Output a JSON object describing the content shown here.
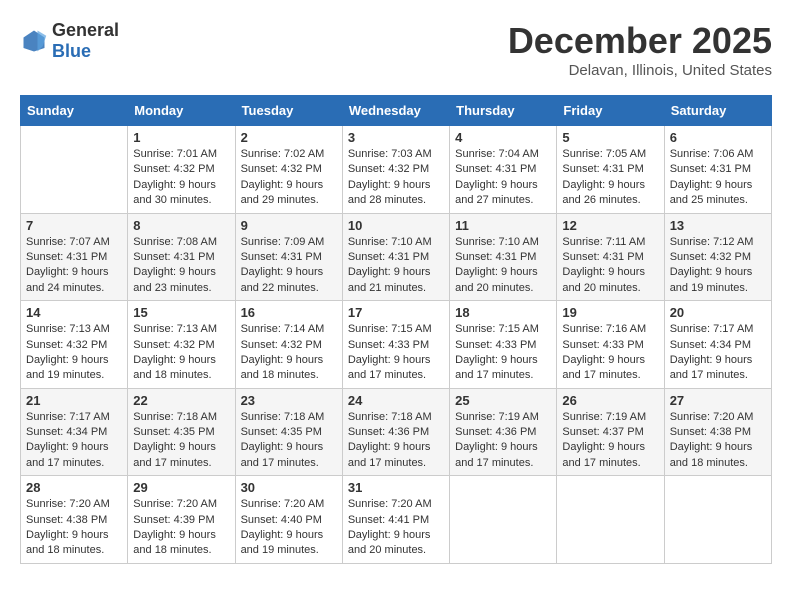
{
  "logo": {
    "general": "General",
    "blue": "Blue"
  },
  "header": {
    "month": "December 2025",
    "location": "Delavan, Illinois, United States"
  },
  "weekdays": [
    "Sunday",
    "Monday",
    "Tuesday",
    "Wednesday",
    "Thursday",
    "Friday",
    "Saturday"
  ],
  "weeks": [
    [
      {
        "day": "",
        "sunrise": "",
        "sunset": "",
        "daylight": ""
      },
      {
        "day": "1",
        "sunrise": "Sunrise: 7:01 AM",
        "sunset": "Sunset: 4:32 PM",
        "daylight": "Daylight: 9 hours and 30 minutes."
      },
      {
        "day": "2",
        "sunrise": "Sunrise: 7:02 AM",
        "sunset": "Sunset: 4:32 PM",
        "daylight": "Daylight: 9 hours and 29 minutes."
      },
      {
        "day": "3",
        "sunrise": "Sunrise: 7:03 AM",
        "sunset": "Sunset: 4:32 PM",
        "daylight": "Daylight: 9 hours and 28 minutes."
      },
      {
        "day": "4",
        "sunrise": "Sunrise: 7:04 AM",
        "sunset": "Sunset: 4:31 PM",
        "daylight": "Daylight: 9 hours and 27 minutes."
      },
      {
        "day": "5",
        "sunrise": "Sunrise: 7:05 AM",
        "sunset": "Sunset: 4:31 PM",
        "daylight": "Daylight: 9 hours and 26 minutes."
      },
      {
        "day": "6",
        "sunrise": "Sunrise: 7:06 AM",
        "sunset": "Sunset: 4:31 PM",
        "daylight": "Daylight: 9 hours and 25 minutes."
      }
    ],
    [
      {
        "day": "7",
        "sunrise": "Sunrise: 7:07 AM",
        "sunset": "Sunset: 4:31 PM",
        "daylight": "Daylight: 9 hours and 24 minutes."
      },
      {
        "day": "8",
        "sunrise": "Sunrise: 7:08 AM",
        "sunset": "Sunset: 4:31 PM",
        "daylight": "Daylight: 9 hours and 23 minutes."
      },
      {
        "day": "9",
        "sunrise": "Sunrise: 7:09 AM",
        "sunset": "Sunset: 4:31 PM",
        "daylight": "Daylight: 9 hours and 22 minutes."
      },
      {
        "day": "10",
        "sunrise": "Sunrise: 7:10 AM",
        "sunset": "Sunset: 4:31 PM",
        "daylight": "Daylight: 9 hours and 21 minutes."
      },
      {
        "day": "11",
        "sunrise": "Sunrise: 7:10 AM",
        "sunset": "Sunset: 4:31 PM",
        "daylight": "Daylight: 9 hours and 20 minutes."
      },
      {
        "day": "12",
        "sunrise": "Sunrise: 7:11 AM",
        "sunset": "Sunset: 4:31 PM",
        "daylight": "Daylight: 9 hours and 20 minutes."
      },
      {
        "day": "13",
        "sunrise": "Sunrise: 7:12 AM",
        "sunset": "Sunset: 4:32 PM",
        "daylight": "Daylight: 9 hours and 19 minutes."
      }
    ],
    [
      {
        "day": "14",
        "sunrise": "Sunrise: 7:13 AM",
        "sunset": "Sunset: 4:32 PM",
        "daylight": "Daylight: 9 hours and 19 minutes."
      },
      {
        "day": "15",
        "sunrise": "Sunrise: 7:13 AM",
        "sunset": "Sunset: 4:32 PM",
        "daylight": "Daylight: 9 hours and 18 minutes."
      },
      {
        "day": "16",
        "sunrise": "Sunrise: 7:14 AM",
        "sunset": "Sunset: 4:32 PM",
        "daylight": "Daylight: 9 hours and 18 minutes."
      },
      {
        "day": "17",
        "sunrise": "Sunrise: 7:15 AM",
        "sunset": "Sunset: 4:33 PM",
        "daylight": "Daylight: 9 hours and 17 minutes."
      },
      {
        "day": "18",
        "sunrise": "Sunrise: 7:15 AM",
        "sunset": "Sunset: 4:33 PM",
        "daylight": "Daylight: 9 hours and 17 minutes."
      },
      {
        "day": "19",
        "sunrise": "Sunrise: 7:16 AM",
        "sunset": "Sunset: 4:33 PM",
        "daylight": "Daylight: 9 hours and 17 minutes."
      },
      {
        "day": "20",
        "sunrise": "Sunrise: 7:17 AM",
        "sunset": "Sunset: 4:34 PM",
        "daylight": "Daylight: 9 hours and 17 minutes."
      }
    ],
    [
      {
        "day": "21",
        "sunrise": "Sunrise: 7:17 AM",
        "sunset": "Sunset: 4:34 PM",
        "daylight": "Daylight: 9 hours and 17 minutes."
      },
      {
        "day": "22",
        "sunrise": "Sunrise: 7:18 AM",
        "sunset": "Sunset: 4:35 PM",
        "daylight": "Daylight: 9 hours and 17 minutes."
      },
      {
        "day": "23",
        "sunrise": "Sunrise: 7:18 AM",
        "sunset": "Sunset: 4:35 PM",
        "daylight": "Daylight: 9 hours and 17 minutes."
      },
      {
        "day": "24",
        "sunrise": "Sunrise: 7:18 AM",
        "sunset": "Sunset: 4:36 PM",
        "daylight": "Daylight: 9 hours and 17 minutes."
      },
      {
        "day": "25",
        "sunrise": "Sunrise: 7:19 AM",
        "sunset": "Sunset: 4:36 PM",
        "daylight": "Daylight: 9 hours and 17 minutes."
      },
      {
        "day": "26",
        "sunrise": "Sunrise: 7:19 AM",
        "sunset": "Sunset: 4:37 PM",
        "daylight": "Daylight: 9 hours and 17 minutes."
      },
      {
        "day": "27",
        "sunrise": "Sunrise: 7:20 AM",
        "sunset": "Sunset: 4:38 PM",
        "daylight": "Daylight: 9 hours and 18 minutes."
      }
    ],
    [
      {
        "day": "28",
        "sunrise": "Sunrise: 7:20 AM",
        "sunset": "Sunset: 4:38 PM",
        "daylight": "Daylight: 9 hours and 18 minutes."
      },
      {
        "day": "29",
        "sunrise": "Sunrise: 7:20 AM",
        "sunset": "Sunset: 4:39 PM",
        "daylight": "Daylight: 9 hours and 18 minutes."
      },
      {
        "day": "30",
        "sunrise": "Sunrise: 7:20 AM",
        "sunset": "Sunset: 4:40 PM",
        "daylight": "Daylight: 9 hours and 19 minutes."
      },
      {
        "day": "31",
        "sunrise": "Sunrise: 7:20 AM",
        "sunset": "Sunset: 4:41 PM",
        "daylight": "Daylight: 9 hours and 20 minutes."
      },
      {
        "day": "",
        "sunrise": "",
        "sunset": "",
        "daylight": ""
      },
      {
        "day": "",
        "sunrise": "",
        "sunset": "",
        "daylight": ""
      },
      {
        "day": "",
        "sunrise": "",
        "sunset": "",
        "daylight": ""
      }
    ]
  ]
}
